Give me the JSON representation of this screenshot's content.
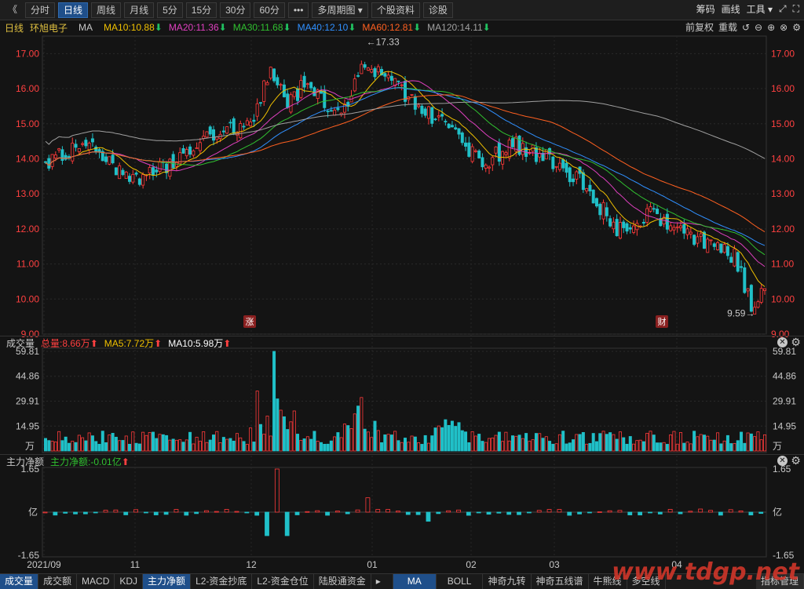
{
  "toolbar": {
    "back": "《",
    "items": [
      "分时",
      "日线",
      "周线",
      "月线",
      "5分",
      "15分",
      "30分",
      "60分",
      "•••",
      "多周期图 ▾",
      "个股资料",
      "诊股"
    ],
    "right": [
      "筹码",
      "画线",
      "工具 ▾"
    ]
  },
  "info": {
    "period": "日线",
    "name": "环旭电子",
    "ma_label": "MA",
    "mas": [
      {
        "text": "MA10:10.88",
        "color": "#f0c000"
      },
      {
        "text": "MA20:11.36",
        "color": "#e040c0"
      },
      {
        "text": "MA30:11.68",
        "color": "#30c030"
      },
      {
        "text": "MA40:12.10",
        "color": "#3090ff"
      },
      {
        "text": "MA60:12.81",
        "color": "#ff6020"
      },
      {
        "text": "MA120:14.11",
        "color": "#a0a0a0"
      }
    ],
    "down_arrow": "⬇",
    "fq": "前复权",
    "zz": "重载"
  },
  "price_axis": [
    "17.00",
    "16.00",
    "15.00",
    "14.00",
    "13.00",
    "12.00",
    "11.00",
    "10.00",
    "9.00"
  ],
  "price_high": "17.33",
  "price_low": "9.59",
  "badges": [
    "涨",
    "财"
  ],
  "volume": {
    "title": "成交量",
    "total": "总量:8.66万",
    "ma5": "MA5:7.72万",
    "ma10": "MA10:5.98万",
    "up_arrow": "⬆",
    "axis": [
      "59.81",
      "44.86",
      "29.91",
      "14.95"
    ],
    "unit": "万"
  },
  "flow": {
    "title": "主力净额",
    "value": "主力净额:-0.01亿",
    "up_arrow": "⬆",
    "axis": [
      "1.65",
      "-1.65"
    ],
    "unit": "亿"
  },
  "xaxis": [
    "2021/09",
    "11",
    "12",
    "01",
    "02",
    "03",
    "04"
  ],
  "bottom_left": [
    "成交量",
    "成交额",
    "MACD",
    "KDJ",
    "主力净额",
    "L2-资金抄底",
    "L2-资金仓位",
    "陆股通资金"
  ],
  "bottom_right": [
    "MA",
    "BOLL",
    "神奇九转",
    "神奇五线谱",
    "牛熊线",
    "多空线",
    "指标管理"
  ],
  "watermark": "www.tdgp.net",
  "chart_data": {
    "type": "candlestick",
    "x_range": [
      "2021/09",
      "2022/04"
    ],
    "price_ylim": [
      9.0,
      17.5
    ],
    "price_range_labels": {
      "high": 17.33,
      "low": 9.59
    },
    "volume_ylim": [
      0,
      59.81
    ],
    "volume_unit": "万",
    "flow_ylim": [
      -1.65,
      1.65
    ],
    "flow_unit": "亿",
    "latest": {
      "MA10": 10.88,
      "MA20": 11.36,
      "MA30": 11.68,
      "MA40": 12.1,
      "MA60": 12.81,
      "MA120": 14.11,
      "volume_total": 8.66,
      "vol_MA5": 7.72,
      "vol_MA10": 5.98,
      "main_net": -0.01
    },
    "ma_colors": {
      "MA10": "#f0c000",
      "MA20": "#e040c0",
      "MA30": "#30c030",
      "MA40": "#3090ff",
      "MA60": "#ff6020",
      "MA120": "#a0a0a0"
    }
  }
}
